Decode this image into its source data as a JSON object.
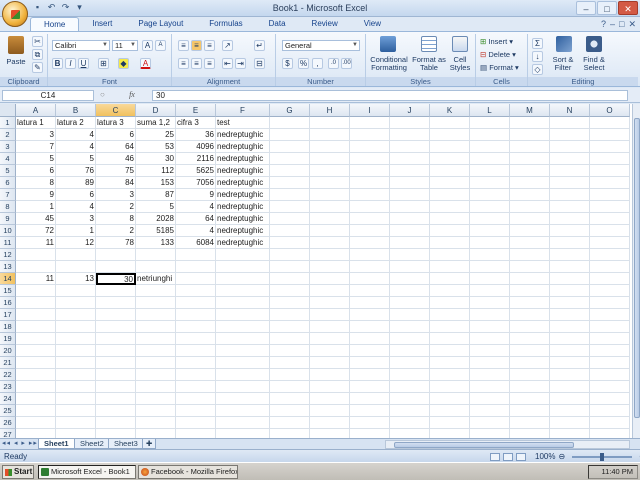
{
  "title": "Book1 - Microsoft Excel",
  "tabs": [
    "Home",
    "Insert",
    "Page Layout",
    "Formulas",
    "Data",
    "Review",
    "View"
  ],
  "ribbon": {
    "clipboard": {
      "label": "Clipboard",
      "paste": "Paste"
    },
    "font": {
      "label": "Font",
      "name": "Calibri",
      "size": "11"
    },
    "alignment": {
      "label": "Alignment"
    },
    "number": {
      "label": "Number",
      "format": "General"
    },
    "styles": {
      "label": "Styles",
      "conditional": "Conditional Formatting",
      "format_table": "Format as Table",
      "cell_styles": "Cell Styles"
    },
    "cells": {
      "label": "Cells",
      "insert": "Insert",
      "delete": "Delete",
      "format": "Format"
    },
    "editing": {
      "label": "Editing",
      "sort": "Sort & Filter",
      "find": "Find & Select"
    }
  },
  "formula_bar": {
    "name_box": "C14",
    "fx": "fx",
    "value": "30"
  },
  "columns": [
    "A",
    "B",
    "C",
    "D",
    "E",
    "F",
    "G",
    "H",
    "I",
    "J",
    "K",
    "L",
    "M",
    "N",
    "O"
  ],
  "selected_col": "C",
  "selected_row": 14,
  "rows": [
    [
      "latura 1",
      "latura 2",
      "latura 3",
      "suma 1,2",
      "cifra 3",
      "test"
    ],
    [
      "3",
      "4",
      "6",
      "25",
      "36",
      "nedreptughic"
    ],
    [
      "7",
      "4",
      "64",
      "53",
      "4096",
      "nedreptughic"
    ],
    [
      "5",
      "5",
      "46",
      "30",
      "2116",
      "nedreptughic"
    ],
    [
      "6",
      "76",
      "75",
      "112",
      "5625",
      "nedreptughic"
    ],
    [
      "8",
      "89",
      "84",
      "153",
      "7056",
      "nedreptughic"
    ],
    [
      "9",
      "6",
      "3",
      "87",
      "9",
      "nedreptughic"
    ],
    [
      "1",
      "4",
      "2",
      "5",
      "4",
      "nedreptughic"
    ],
    [
      "45",
      "3",
      "8",
      "2028",
      "64",
      "nedreptughic"
    ],
    [
      "72",
      "1",
      "2",
      "5185",
      "4",
      "nedreptughic"
    ],
    [
      "11",
      "12",
      "78",
      "133",
      "6084",
      "nedreptughic"
    ],
    [],
    [],
    [
      "11",
      "13",
      "30",
      "netriunghi"
    ],
    [],
    [],
    [],
    [],
    [],
    [],
    [],
    [],
    [],
    [],
    [],
    [],
    []
  ],
  "sheets": [
    "Sheet1",
    "Sheet2",
    "Sheet3"
  ],
  "active_sheet": "Sheet1",
  "status": {
    "ready": "Ready",
    "zoom": "100%"
  },
  "taskbar": {
    "start": "Start",
    "tasks": [
      "Microsoft Excel - Book1",
      "Facebook - Mozilla Firefox"
    ],
    "clock": "11:40 PM"
  }
}
